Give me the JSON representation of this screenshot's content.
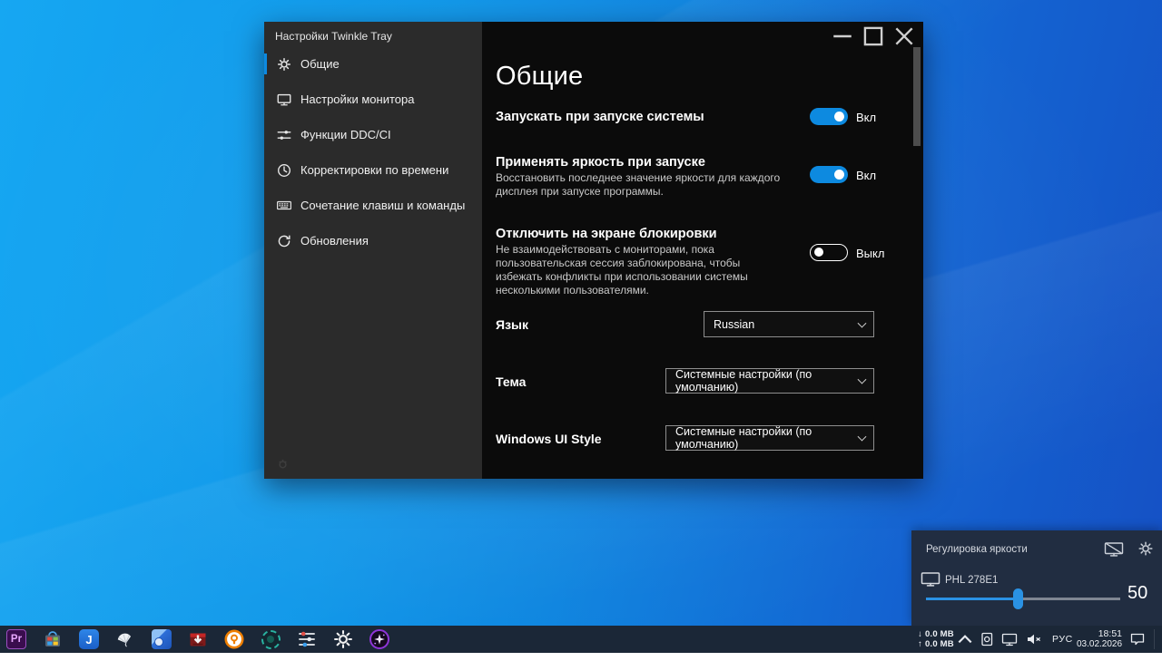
{
  "colors": {
    "accent_blue": "#0d8ae0",
    "wallpaper_left": "#16a7f2",
    "wallpaper_right": "#1550c4",
    "taskbar_bg": "#1b2737",
    "flyout_bg": "#212d41",
    "sidebar_bg": "#2b2b2b",
    "content_bg": "#0b0b0b"
  },
  "window": {
    "title": "Настройки Twinkle Tray",
    "sidebar": {
      "items": [
        {
          "label": "Общие"
        },
        {
          "label": "Настройки монитора"
        },
        {
          "label": "Функции DDC/CI"
        },
        {
          "label": "Корректировки по времени"
        },
        {
          "label": "Сочетание клавиш и команды"
        },
        {
          "label": "Обновления"
        }
      ]
    },
    "content": {
      "heading": "Общие",
      "settings": [
        {
          "title": "Запускать при запуске системы",
          "toggle_label": "Вкл"
        },
        {
          "title": "Применять яркость при запуске",
          "description": "Восстановить последнее значение яркости для каждого дисплея при запуске программы.",
          "toggle_label": "Вкл"
        },
        {
          "title": "Отключить на экране блокировки",
          "description": "Не взаимодействовать с мониторами, пока пользовательская сессия заблокирована, чтобы избежать конфликты при использовании системы несколькими пользователями.",
          "toggle_label": "Выкл"
        }
      ],
      "selects": [
        {
          "label": "Язык",
          "value": "Russian"
        },
        {
          "label": "Тема",
          "value": "Системные настройки (по умолчанию)"
        },
        {
          "label": "Windows UI Style",
          "value": "Системные настройки (по умолчанию)"
        }
      ]
    }
  },
  "flyout": {
    "title": "Регулировка яркости",
    "monitor_name": "PHL 278E1",
    "brightness_value": "50"
  },
  "taskbar": {
    "apps": {
      "premiere_label": "Pr",
      "joplin_label": "J"
    },
    "tray": {
      "down_arrow": "↓",
      "up_arrow": "↑",
      "net_down": "0.0 MB",
      "net_up": "0.0 MB",
      "lang": "РУС",
      "time": "18:51",
      "date": "03.02.2026"
    }
  }
}
